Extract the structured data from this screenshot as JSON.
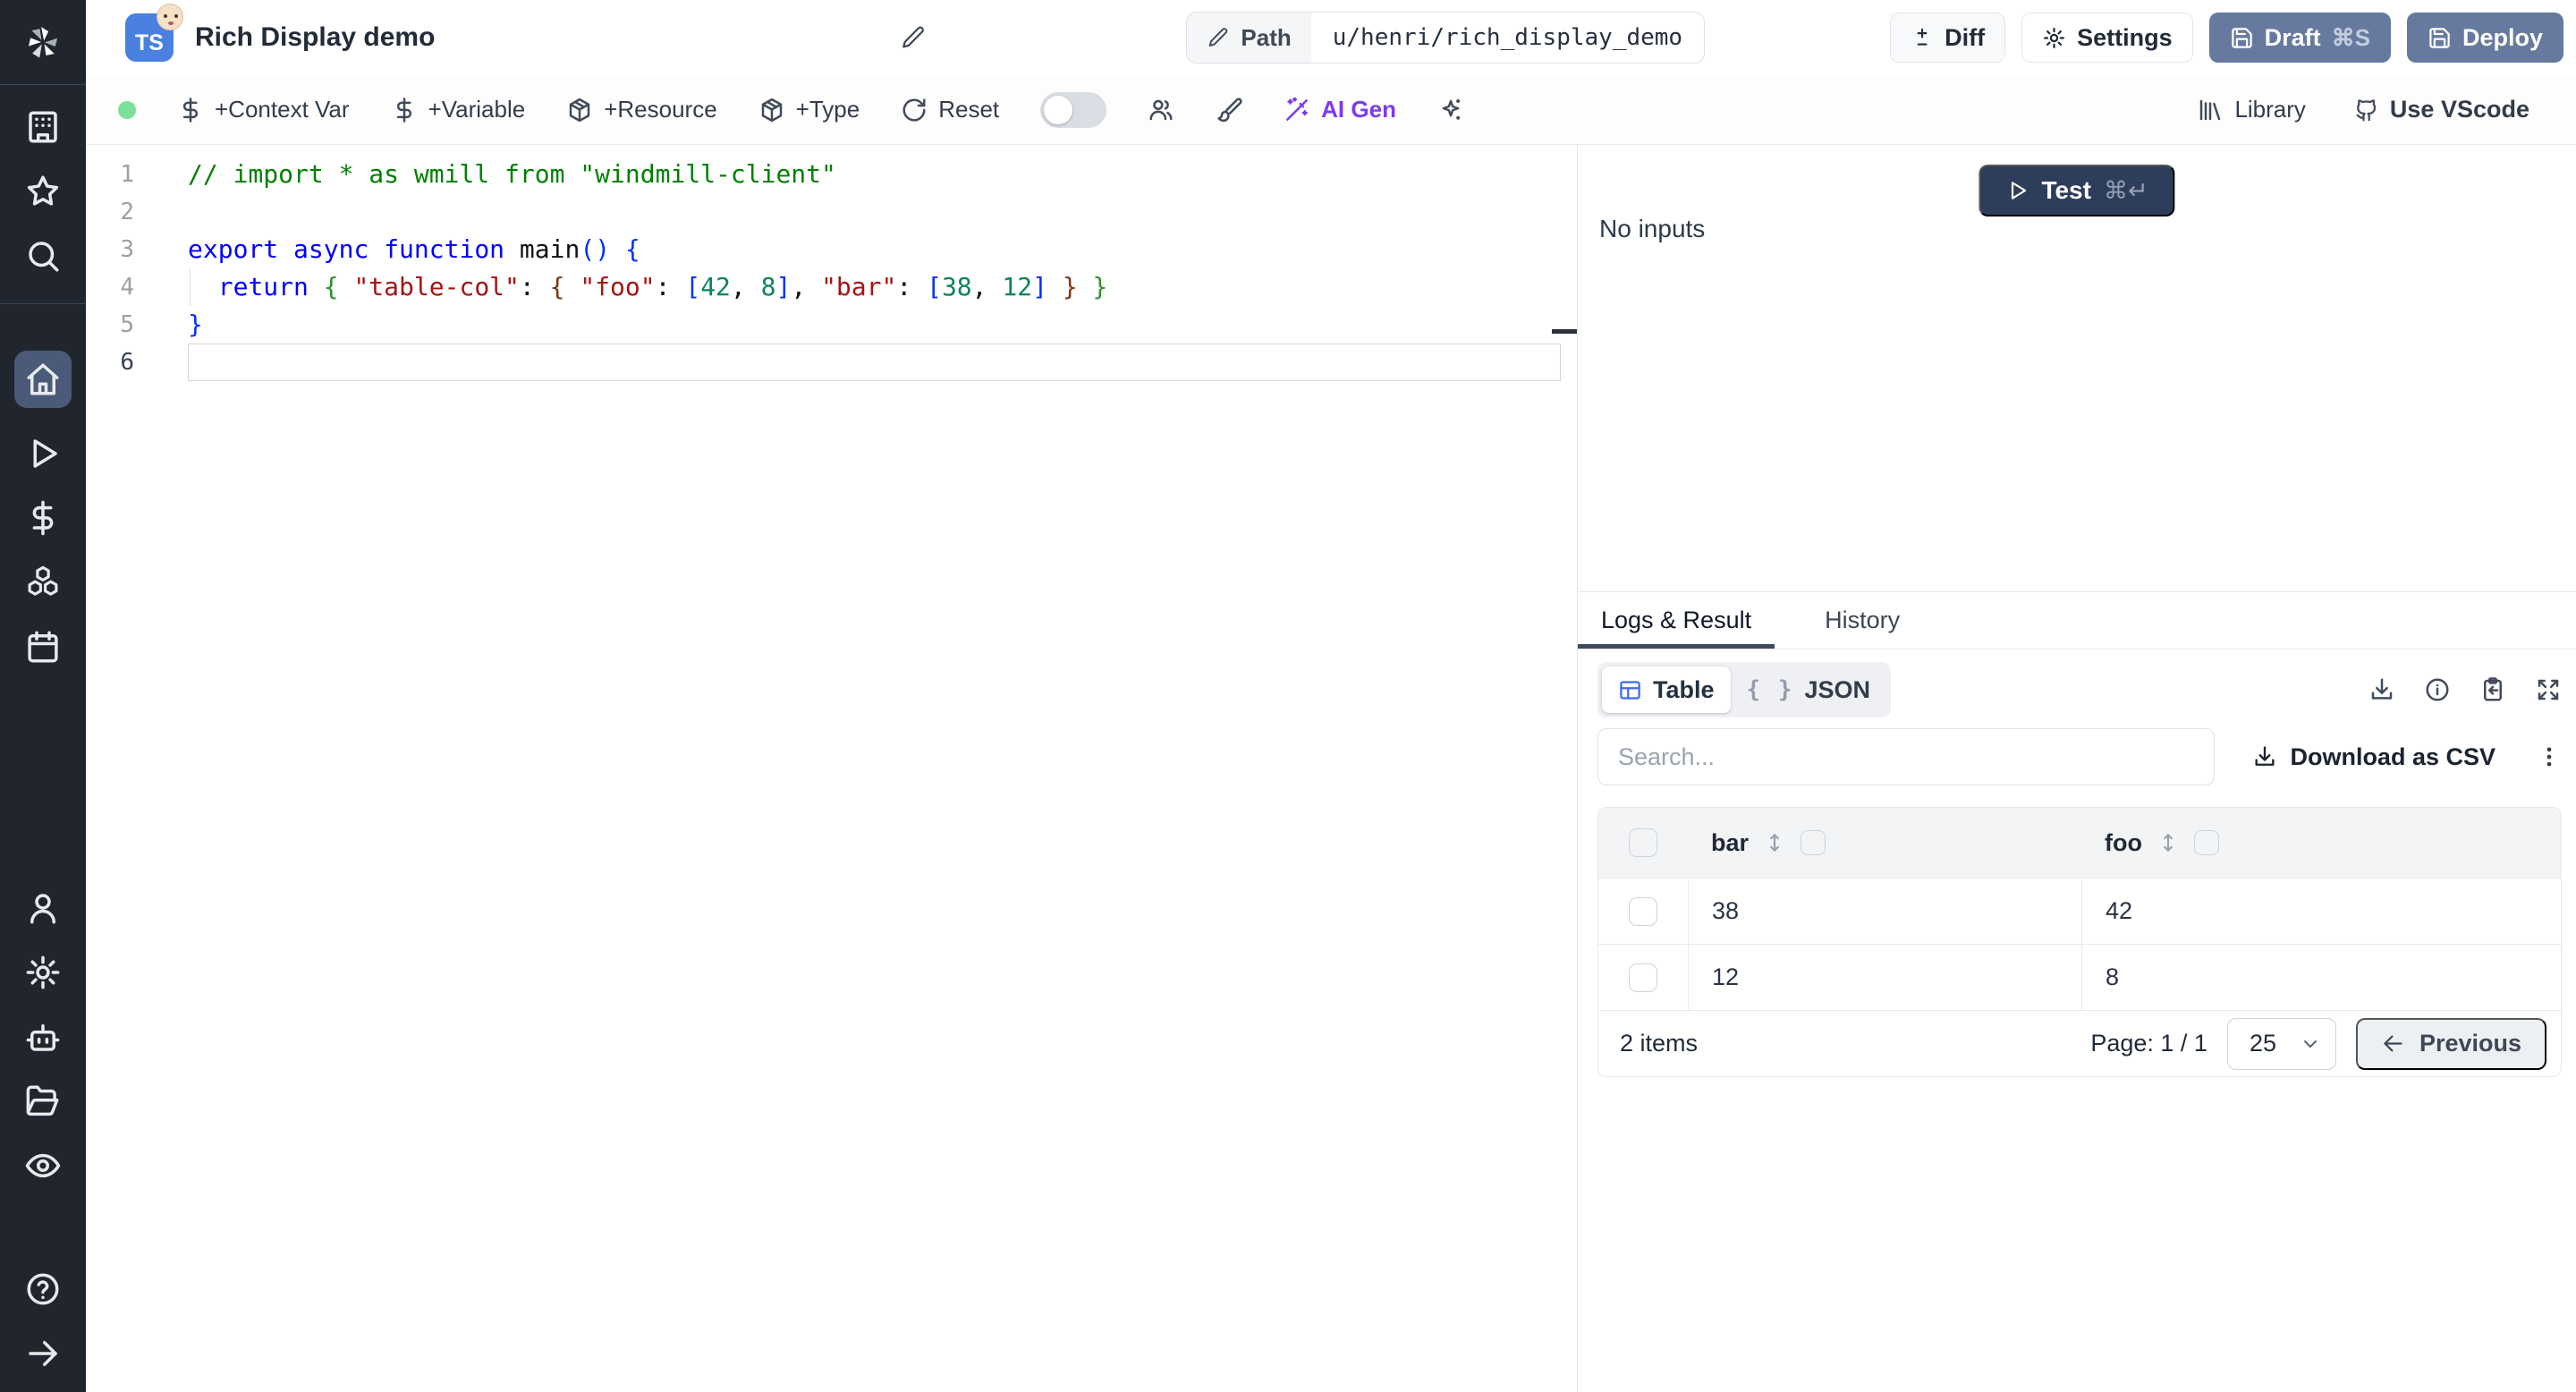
{
  "colors": {
    "sidebar_bg": "#21252d",
    "active_item_bg": "#4a5a78",
    "slate_button": "#66799e",
    "test_button": "#2e3d59",
    "ai_purple": "#7c3aed",
    "green_status_dot": "#7ddf9c",
    "ts_badge_blue": "#4a80e0",
    "table_icon_blue": "#3b6bf7",
    "tab_underline": "#3f4a5c"
  },
  "sidebar": {
    "icons_top": [
      "windmill-logo",
      "building-icon",
      "star-icon",
      "search-icon"
    ],
    "icons_main": [
      "home-icon",
      "play-icon",
      "dollar-icon",
      "boxes-icon",
      "calendar-icon"
    ],
    "icons_lower": [
      "user-icon",
      "gear-icon",
      "bot-icon",
      "folder-open-icon",
      "eye-icon"
    ],
    "icons_bottom": [
      "help-circle-icon",
      "arrow-right-icon"
    ],
    "active": "home-icon"
  },
  "header": {
    "badge": "TS",
    "title": "Rich Display demo",
    "path_label": "Path",
    "path_value": "u/henri/rich_display_demo",
    "buttons": {
      "diff": "Diff",
      "settings": "Settings",
      "draft": "Draft",
      "draft_shortcut": "⌘S",
      "deploy": "Deploy"
    }
  },
  "toolbar": {
    "context_var": "+Context Var",
    "variable": "+Variable",
    "resource": "+Resource",
    "type": "+Type",
    "reset": "Reset",
    "ai_gen": "AI Gen",
    "library": "Library",
    "use_vscode": "Use VScode"
  },
  "editor": {
    "language": "typescript",
    "lines": [
      {
        "n": "1",
        "tokens": [
          {
            "t": "// import * as wmill from \"windmill-client\"",
            "c": "com"
          }
        ]
      },
      {
        "n": "2",
        "tokens": []
      },
      {
        "n": "3",
        "tokens": [
          {
            "t": "export",
            "c": "kw"
          },
          {
            "t": " "
          },
          {
            "t": "async",
            "c": "kw"
          },
          {
            "t": " "
          },
          {
            "t": "function",
            "c": "kw"
          },
          {
            "t": " "
          },
          {
            "t": "main",
            "c": "id"
          },
          {
            "t": "(",
            "c": "b1"
          },
          {
            "t": ")",
            "c": "b1"
          },
          {
            "t": " "
          },
          {
            "t": "{",
            "c": "b1"
          }
        ]
      },
      {
        "n": "4",
        "guide": true,
        "tokens": [
          {
            "t": "  "
          },
          {
            "t": "return",
            "c": "kw"
          },
          {
            "t": " "
          },
          {
            "t": "{",
            "c": "b2"
          },
          {
            "t": " "
          },
          {
            "t": "\"table-col\"",
            "c": "str"
          },
          {
            "t": ": ",
            "c": "pl"
          },
          {
            "t": "{",
            "c": "b3"
          },
          {
            "t": " "
          },
          {
            "t": "\"foo\"",
            "c": "str"
          },
          {
            "t": ": ",
            "c": "pl"
          },
          {
            "t": "[",
            "c": "b1"
          },
          {
            "t": "42",
            "c": "num"
          },
          {
            "t": ", ",
            "c": "pl"
          },
          {
            "t": "8",
            "c": "num"
          },
          {
            "t": "]",
            "c": "b1"
          },
          {
            "t": ", ",
            "c": "pl"
          },
          {
            "t": "\"bar\"",
            "c": "str"
          },
          {
            "t": ": ",
            "c": "pl"
          },
          {
            "t": "[",
            "c": "b1"
          },
          {
            "t": "38",
            "c": "num"
          },
          {
            "t": ", ",
            "c": "pl"
          },
          {
            "t": "12",
            "c": "num"
          },
          {
            "t": "]",
            "c": "b1"
          },
          {
            "t": " "
          },
          {
            "t": "}",
            "c": "b3"
          },
          {
            "t": " "
          },
          {
            "t": "}",
            "c": "b2"
          }
        ]
      },
      {
        "n": "5",
        "tokens": [
          {
            "t": "}",
            "c": "b1"
          }
        ]
      },
      {
        "n": "6",
        "current": true,
        "tokens": []
      }
    ]
  },
  "right_panel": {
    "test": "Test",
    "test_shortcut": "⌘↵",
    "no_inputs": "No inputs",
    "tabs": {
      "logs": "Logs & Result",
      "history": "History"
    },
    "view_toggle": {
      "table": "Table",
      "json": "JSON",
      "braces_glyph": "{ }"
    },
    "result_icons": [
      "download-icon",
      "info-icon",
      "clipboard-copy-icon",
      "expand-icon"
    ],
    "search_placeholder": "Search...",
    "download_csv": "Download as CSV"
  },
  "result_table": {
    "columns": [
      "bar",
      "foo"
    ],
    "rows": [
      [
        "38",
        "42"
      ],
      [
        "12",
        "8"
      ]
    ],
    "items_label": "2 items",
    "page_label": "Page: 1 / 1",
    "page_size": "25",
    "previous": "Previous"
  }
}
